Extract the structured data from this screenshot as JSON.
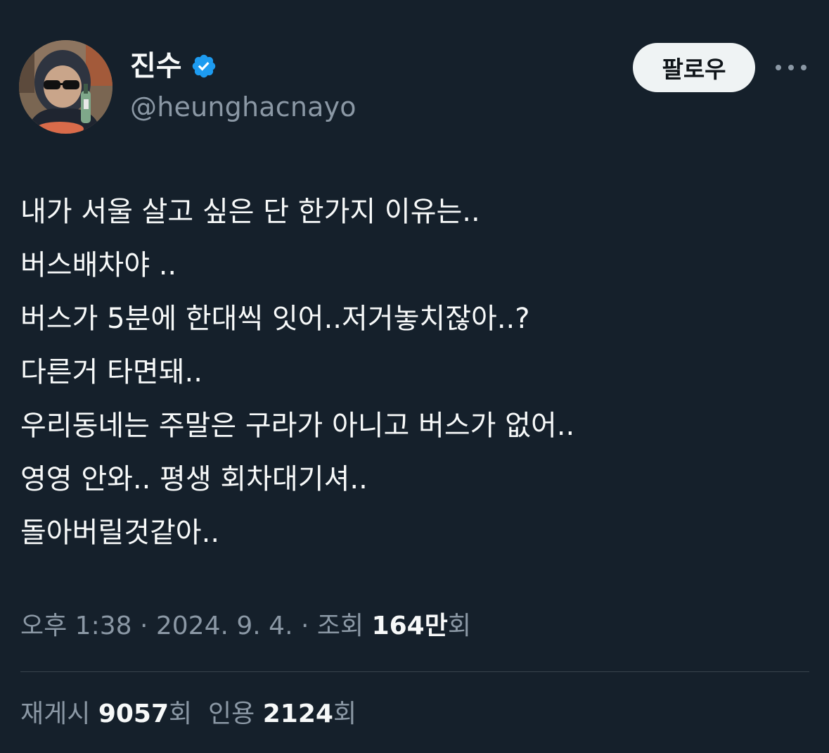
{
  "author": {
    "display_name": "진수",
    "handle": "@heunghacnayo",
    "verified": true,
    "verified_color": "#1d9bf0"
  },
  "actions": {
    "follow_label": "팔로우",
    "more_icon": "more-horizontal-icon"
  },
  "tweet": {
    "lines": [
      "내가 서울 살고 싶은 단 한가지 이유는..",
      "버스배차야 ..",
      "버스가 5분에 한대씩 잇어..저거놓치잖아..?",
      "다른거 타면돼..",
      "우리동네는 주말은 구라가 아니고 버스가 없어..",
      "영영 안와.. 평생 회차대기셔..",
      "돌아버릴것같아.."
    ]
  },
  "meta": {
    "time": "오후 1:38",
    "separator": " · ",
    "date": "2024. 9. 4.",
    "views_label": "조회",
    "views_value": "164만",
    "views_suffix": "회"
  },
  "stats": {
    "reposts_label": "재게시",
    "reposts_value": "9057",
    "reposts_suffix": "회",
    "quotes_label": "인용",
    "quotes_value": "2124",
    "quotes_suffix": "회"
  },
  "colors": {
    "background": "#15202b",
    "primary_text": "#f7f9f9",
    "secondary_text": "#8b98a5",
    "divider": "#38444d",
    "follow_bg": "#eff3f4"
  }
}
